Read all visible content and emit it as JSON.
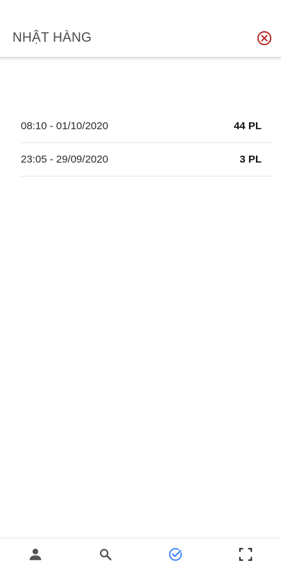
{
  "header": {
    "title": "NHẬT HÀNG",
    "close_icon": "close-circle-icon",
    "close_color": "#b71c1c"
  },
  "entries": [
    {
      "time": "08:10 - 01/10/2020",
      "quantity": "44 PL"
    },
    {
      "time": "23:05 - 29/09/2020",
      "quantity": "3 PL"
    }
  ],
  "bottom_nav": {
    "items": [
      {
        "icon": "person-icon",
        "active": false
      },
      {
        "icon": "search-icon",
        "active": false
      },
      {
        "icon": "check-circle-icon",
        "active": true
      },
      {
        "icon": "scan-icon",
        "active": false
      }
    ],
    "active_color": "#3b82f6",
    "inactive_color": "#555555"
  }
}
